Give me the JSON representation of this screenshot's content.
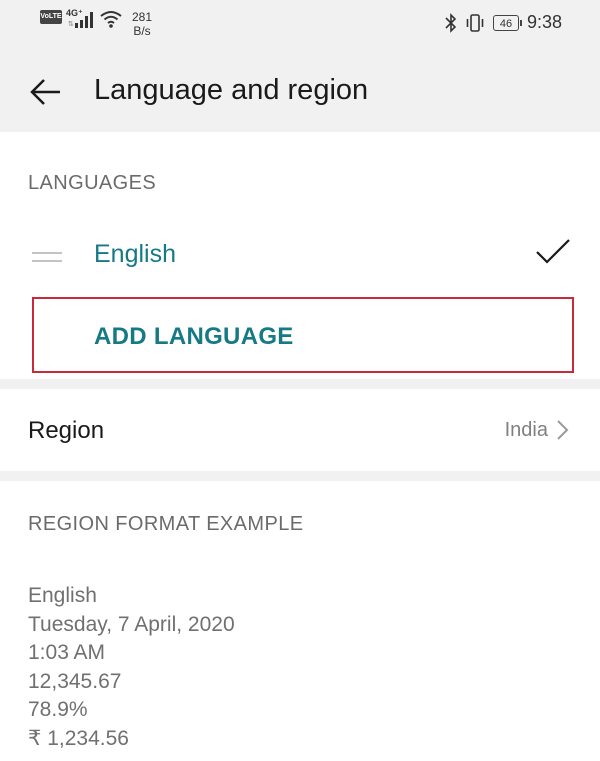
{
  "status_bar": {
    "volte": "VoLTE",
    "network": "4G⁺",
    "network_sub": "⇅",
    "speed_value": "281",
    "speed_unit": "B/s",
    "battery": "46",
    "time": "9:38",
    "icons": [
      "signal-icon",
      "wifi-icon",
      "bluetooth-icon",
      "vibrate-icon",
      "battery-icon"
    ]
  },
  "app_bar": {
    "title": "Language and region",
    "back_icon": "back-arrow-icon"
  },
  "languages": {
    "header": "LANGUAGES",
    "items": [
      {
        "label": "English",
        "selected": true
      }
    ],
    "add_label": "ADD LANGUAGE"
  },
  "region": {
    "label": "Region",
    "value": "India"
  },
  "region_format": {
    "header": "REGION FORMAT EXAMPLE",
    "lines": [
      "English",
      "Tuesday, 7 April, 2020",
      "1:03 AM",
      "12,345.67",
      "78.9%",
      "₹ 1,234.56"
    ]
  },
  "colors": {
    "accent": "#157986",
    "highlight_border": "#c82a3a",
    "background": "#f1f1f1",
    "card": "#ffffff"
  }
}
